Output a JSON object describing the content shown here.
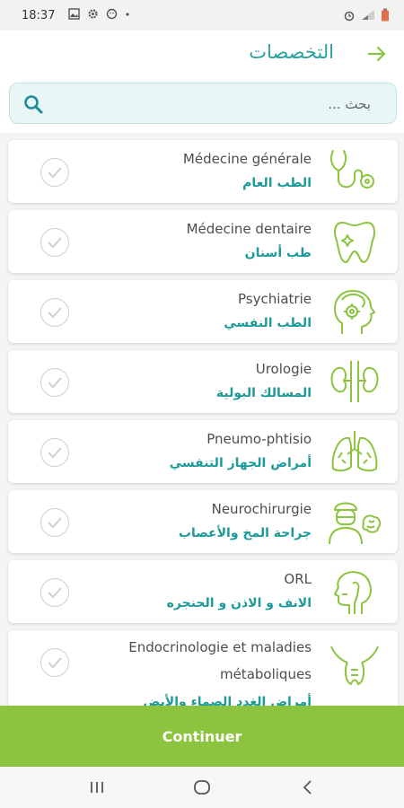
{
  "status": {
    "time": "18:37"
  },
  "header": {
    "title": "التخصصات"
  },
  "search": {
    "placeholder": "بحث ..."
  },
  "specialties": [
    {
      "fr": "Médecine générale",
      "ar": "الطب العام",
      "icon": "stethoscope-icon"
    },
    {
      "fr": "Médecine dentaire",
      "ar": "طب أسنان",
      "icon": "tooth-icon"
    },
    {
      "fr": "Psychiatrie",
      "ar": "الطب النفسي",
      "icon": "head-gear-icon"
    },
    {
      "fr": "Urologie",
      "ar": "المسالك البولية",
      "icon": "kidneys-icon"
    },
    {
      "fr": "Pneumo-phtisio",
      "ar": "أمراض الجهاز التنفسي",
      "icon": "lungs-icon"
    },
    {
      "fr": "Neurochirurgie",
      "ar": "جراحة المخ والأعصاب",
      "icon": "surgeon-brain-icon"
    },
    {
      "fr": "ORL",
      "ar": "الانف و الاذن و الحنجره",
      "icon": "throat-profile-icon"
    },
    {
      "fr": "Endocrinologie et maladies métaboliques",
      "ar": "أمراض الغدد الصماء والأيض",
      "icon": "thyroid-icon"
    }
  ],
  "continue_label": "Continuer",
  "colors": {
    "accent": "#2aa0a0",
    "icon_green": "#8cc43f",
    "button": "#8cc43f"
  }
}
